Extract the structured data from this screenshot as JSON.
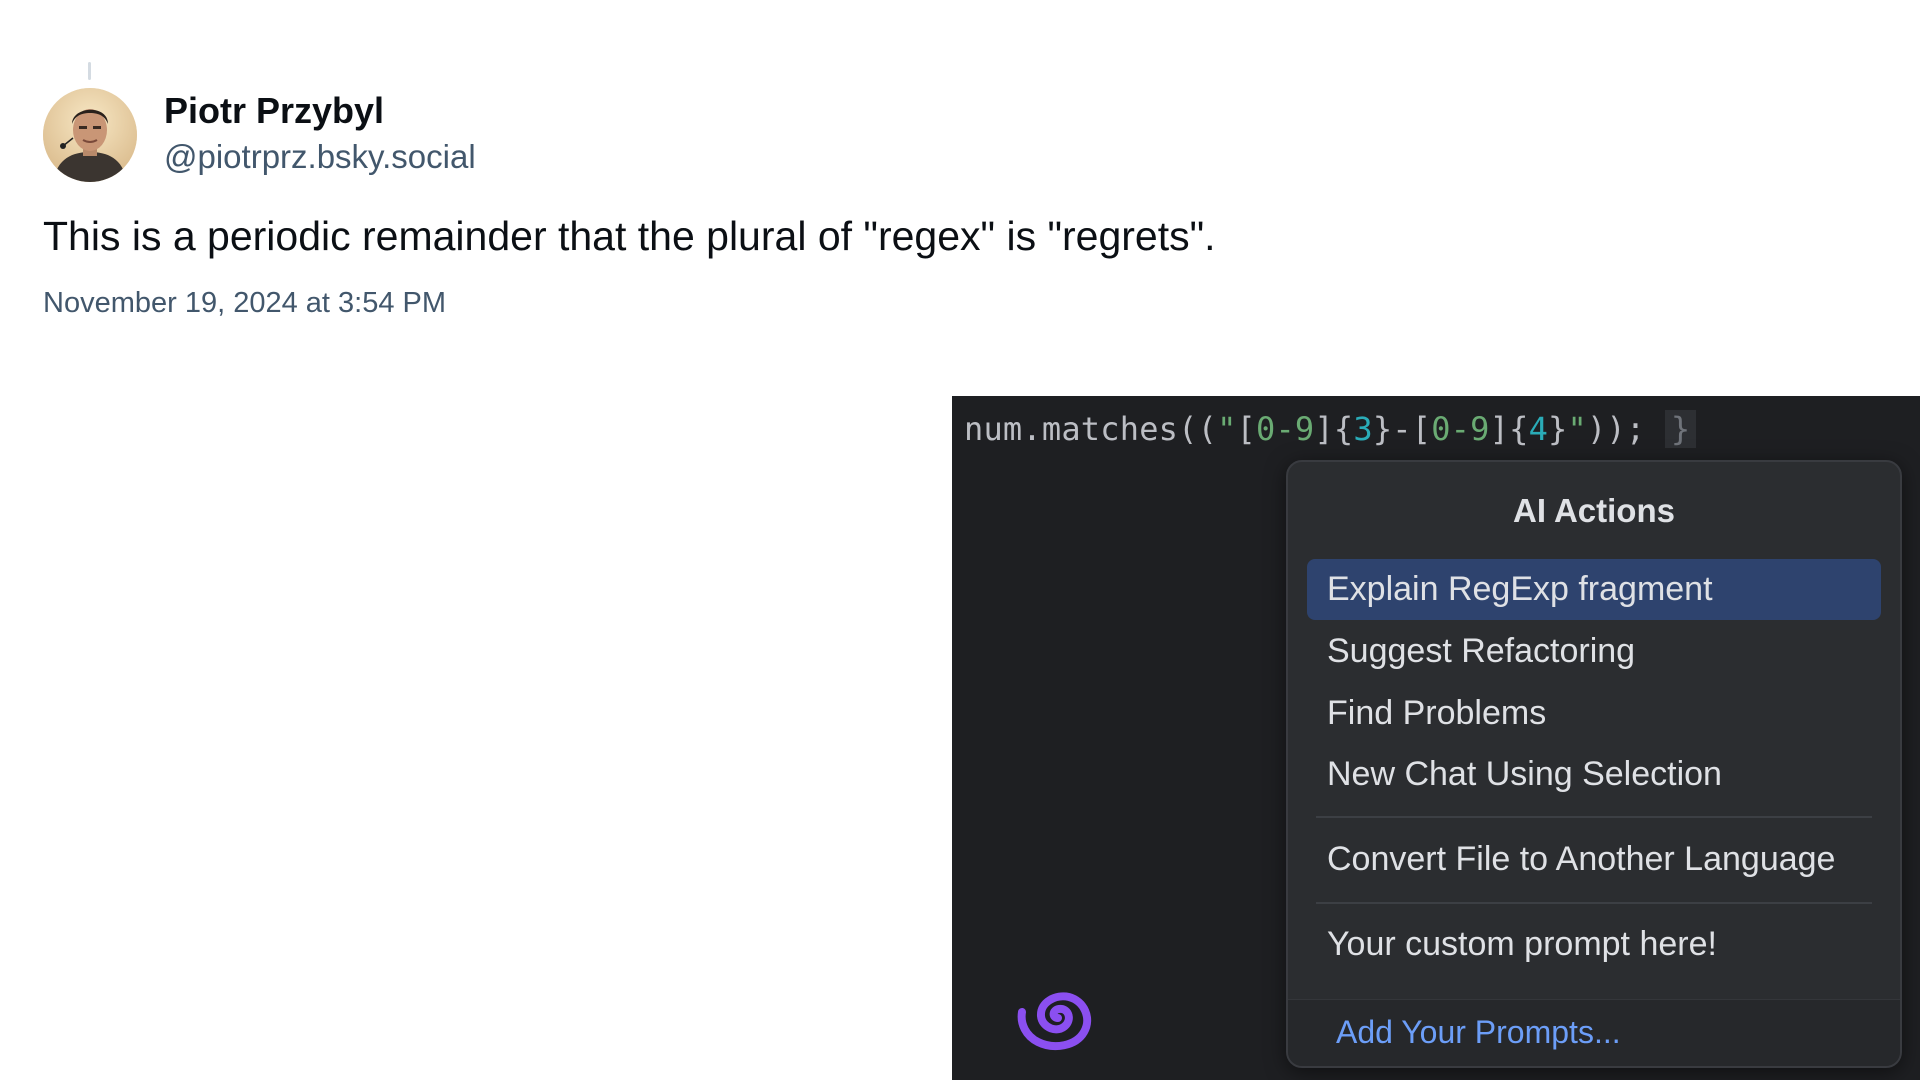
{
  "post": {
    "author_name": "Piotr Przybyl",
    "author_handle": "@piotrprz.bsky.social",
    "text": "This is a periodic remainder that the plural of \"regex\" is \"regrets\".",
    "timestamp": "November 19, 2024 at 3:54 PM"
  },
  "ide": {
    "code": {
      "prefix": "num.matches((",
      "quote_open": "\"",
      "bracket1": "[",
      "range1": "0-9",
      "bracket1_close": "]{",
      "count1": "3",
      "brace_dash": "}-",
      "bracket2": "[",
      "range2": "0-9",
      "bracket2_close": "]{",
      "count2": "4",
      "brace_close": "}",
      "quote_close": "\"",
      "suffix": "));",
      "closing_brace": "}"
    },
    "popup": {
      "title": "AI Actions",
      "items": [
        {
          "label": "Explain RegExp fragment"
        },
        {
          "label": "Suggest Refactoring"
        },
        {
          "label": "Find Problems"
        },
        {
          "label": "New Chat Using Selection"
        },
        {
          "label": "Convert File to Another Language"
        },
        {
          "label": "Your custom prompt here!"
        }
      ],
      "footer_link": "Add Your Prompts..."
    },
    "colors": {
      "background": "#1e1f22",
      "popup_background": "#2b2d30",
      "selection": "#2e436e",
      "link": "#6c9ef8",
      "spiral": "#8b4ff0"
    }
  }
}
